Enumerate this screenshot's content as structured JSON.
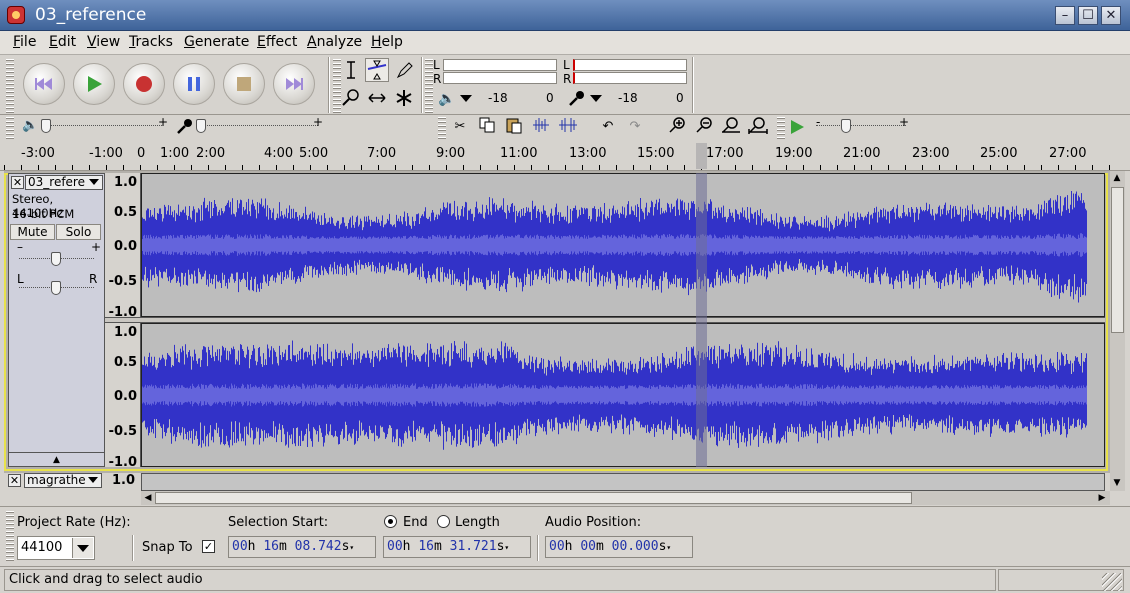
{
  "window": {
    "title": "03_reference",
    "minimize": "–",
    "maximize": "☐",
    "close": "✕"
  },
  "menu": {
    "file_u": "F",
    "file_r": "ile",
    "edit_u": "E",
    "edit_r": "dit",
    "view_u": "V",
    "view_r": "iew",
    "tracks_u": "T",
    "tracks_r": "racks",
    "generate_u": "G",
    "generate_r": "enerate",
    "effect_u": "E",
    "effect_r": "ffect",
    "analyze_u": "A",
    "analyze_r": "nalyze",
    "help_u": "H",
    "help_r": "elp"
  },
  "meters": {
    "l": "L",
    "r": "R",
    "l2": "L",
    "r2": "R",
    "play_db_a": "-18",
    "play_db_b": "0",
    "rec_db_a": "-18",
    "rec_db_b": "0"
  },
  "sliders": {
    "plus1": "+",
    "plus2": "+",
    "minus3": "-",
    "plus3": "+"
  },
  "ruler": {
    "labels": [
      "-3:00",
      "-1:00",
      "0",
      "1:00",
      "2:00",
      "4:00",
      "5:00",
      "7:00",
      "9:00",
      "11:00",
      "13:00",
      "15:00",
      "17:00",
      "19:00",
      "21:00",
      "23:00",
      "25:00",
      "27:00"
    ]
  },
  "track1": {
    "name": "03_refere",
    "info1": "Stereo, 44100Hz",
    "info2": "16-bit PCM",
    "mute": "Mute",
    "solo": "Solo",
    "gain_minus": "–",
    "gain_plus": "+",
    "pan_l": "L",
    "pan_r": "R",
    "collapse": "▲",
    "scale_top": [
      "1.0",
      "0.5",
      "0.0",
      "-0.5",
      "-1.0"
    ],
    "scale_bottom": [
      "1.0",
      "0.5",
      "0.0",
      "-0.5",
      "-1.0"
    ]
  },
  "track2": {
    "name": "magrathe",
    "scale_top": "1.0"
  },
  "status": {
    "project_rate_label": "Project Rate (Hz):",
    "project_rate_value": "44100",
    "snap_to": "Snap To",
    "selection_start_label": "Selection Start:",
    "end_label": "End",
    "length_label": "Length",
    "audio_position_label": "Audio Position:",
    "sel_start": {
      "h": "00",
      "m": "16",
      "s": "08.742"
    },
    "sel_end": {
      "h": "00",
      "m": "16",
      "s": "31.721"
    },
    "audio_pos": {
      "h": "00",
      "m": "00",
      "s": "00.000"
    },
    "h_unit": "h",
    "m_unit": "m",
    "s_unit": "s",
    "message": "Click and drag to select audio"
  },
  "colors": {
    "waveform": "#3232c8",
    "waveform_rms": "#6464dc",
    "selection": "#8c8ca0"
  }
}
